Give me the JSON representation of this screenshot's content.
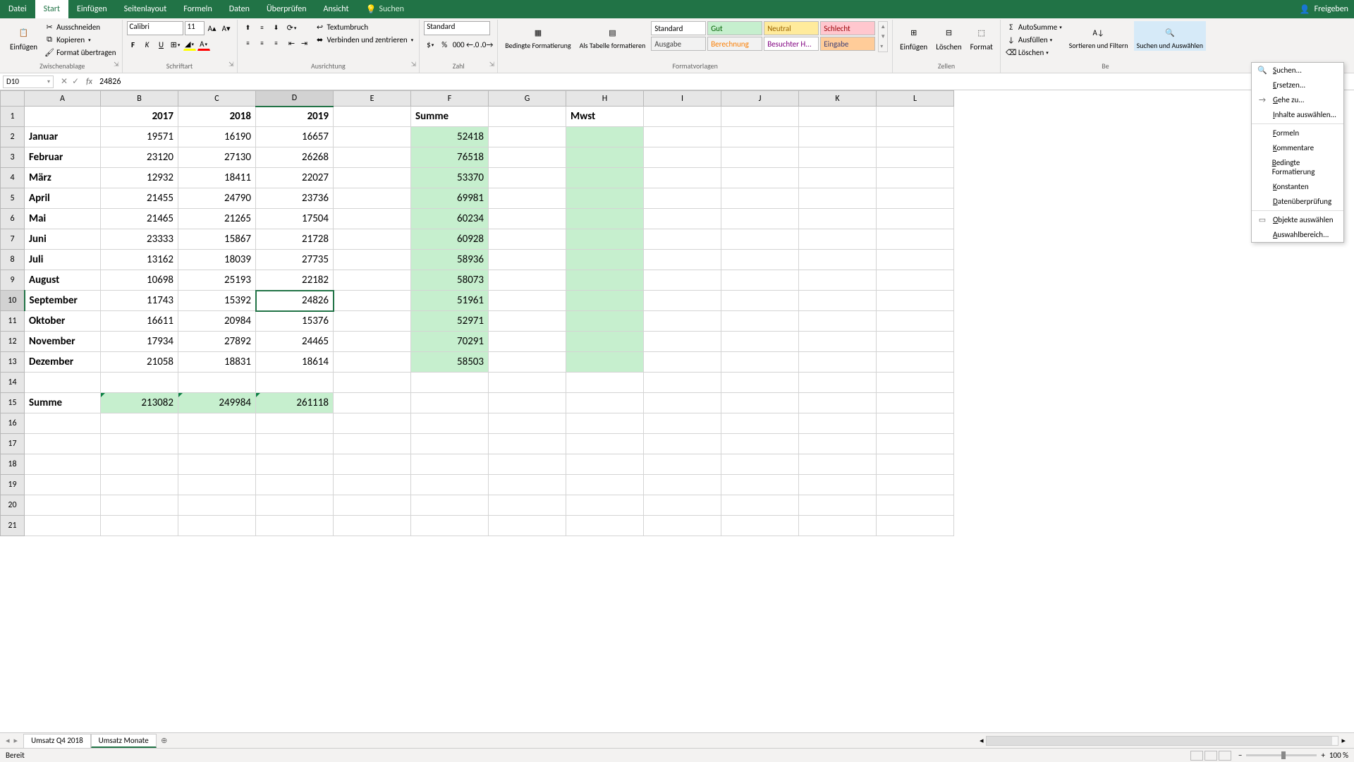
{
  "titlebar": {
    "tabs": [
      "Datei",
      "Start",
      "Einfügen",
      "Seitenlayout",
      "Formeln",
      "Daten",
      "Überprüfen",
      "Ansicht"
    ],
    "active_tab": "Start",
    "search_label": "Suchen",
    "share_label": "Freigeben"
  },
  "ribbon": {
    "clipboard": {
      "paste": "Einfügen",
      "cut": "Ausschneiden",
      "copy": "Kopieren",
      "format_painter": "Format übertragen",
      "title": "Zwischenablage"
    },
    "font": {
      "name": "Calibri",
      "size": "11",
      "title": "Schriftart"
    },
    "alignment": {
      "wrap": "Textumbruch",
      "merge": "Verbinden und zentrieren",
      "title": "Ausrichtung"
    },
    "number": {
      "format": "Standard",
      "title": "Zahl"
    },
    "styles": {
      "cond": "Bedingte Formatierung",
      "table": "Als Tabelle formatieren",
      "cells": [
        {
          "label": "Standard",
          "bg": "#ffffff",
          "fg": "#000000"
        },
        {
          "label": "Gut",
          "bg": "#c6efce",
          "fg": "#006100"
        },
        {
          "label": "Neutral",
          "bg": "#ffeb9c",
          "fg": "#9c6500"
        },
        {
          "label": "Schlecht",
          "bg": "#ffc7ce",
          "fg": "#9c0006"
        },
        {
          "label": "Ausgabe",
          "bg": "#f2f2f2",
          "fg": "#3f3f3f"
        },
        {
          "label": "Berechnung",
          "bg": "#f2f2f2",
          "fg": "#fa7d00"
        },
        {
          "label": "Besuchter H...",
          "bg": "#ffffff",
          "fg": "#800080"
        },
        {
          "label": "Eingabe",
          "bg": "#ffcc99",
          "fg": "#3f3f76"
        }
      ],
      "title": "Formatvorlagen"
    },
    "cells_group": {
      "insert": "Einfügen",
      "delete": "Löschen",
      "format": "Format",
      "title": "Zellen"
    },
    "editing": {
      "autosum": "AutoSumme",
      "fill": "Ausfüllen",
      "clear": "Löschen",
      "sort": "Sortieren und Filtern",
      "find": "Suchen und Auswählen",
      "title": "Be"
    }
  },
  "dropdown": {
    "items": [
      {
        "label": "Suchen...",
        "icon": "🔍"
      },
      {
        "label": "Ersetzen...",
        "icon": ""
      },
      {
        "label": "Gehe zu...",
        "icon": "→"
      },
      {
        "label": "Inhalte auswählen...",
        "icon": ""
      },
      {
        "label": "Formeln",
        "icon": ""
      },
      {
        "label": "Kommentare",
        "icon": ""
      },
      {
        "label": "Bedingte Formatierung",
        "icon": ""
      },
      {
        "label": "Konstanten",
        "icon": ""
      },
      {
        "label": "Datenüberprüfung",
        "icon": ""
      },
      {
        "label": "Objekte auswählen",
        "icon": "▭"
      },
      {
        "label": "Auswahlbereich...",
        "icon": ""
      }
    ]
  },
  "formulabar": {
    "namebox": "D10",
    "value": "24826"
  },
  "columns": [
    "A",
    "B",
    "C",
    "D",
    "E",
    "F",
    "G",
    "H",
    "I",
    "J",
    "K",
    "L"
  ],
  "selected_col": "D",
  "selected_row": 10,
  "sheet": {
    "headers": {
      "b": "2017",
      "c": "2018",
      "d": "2019",
      "f": "Summe",
      "h": "Mwst"
    },
    "rows": [
      {
        "a": "Januar",
        "b": 19571,
        "c": 16190,
        "d": 16657,
        "f": 52418
      },
      {
        "a": "Februar",
        "b": 23120,
        "c": 27130,
        "d": 26268,
        "f": 76518
      },
      {
        "a": "März",
        "b": 12932,
        "c": 18411,
        "d": 22027,
        "f": 53370
      },
      {
        "a": "April",
        "b": 21455,
        "c": 24790,
        "d": 23736,
        "f": 69981
      },
      {
        "a": "Mai",
        "b": 21465,
        "c": 21265,
        "d": 17504,
        "f": 60234
      },
      {
        "a": "Juni",
        "b": 23333,
        "c": 15867,
        "d": 21728,
        "f": 60928
      },
      {
        "a": "Juli",
        "b": 13162,
        "c": 18039,
        "d": 27735,
        "f": 58936
      },
      {
        "a": "August",
        "b": 10698,
        "c": 25193,
        "d": 22182,
        "f": 58073
      },
      {
        "a": "September",
        "b": 11743,
        "c": 15392,
        "d": 24826,
        "f": 51961
      },
      {
        "a": "Oktober",
        "b": 16611,
        "c": 20984,
        "d": 15376,
        "f": 52971
      },
      {
        "a": "November",
        "b": 17934,
        "c": 27892,
        "d": 24465,
        "f": 70291
      },
      {
        "a": "Dezember",
        "b": 21058,
        "c": 18831,
        "d": 18614,
        "f": 58503
      }
    ],
    "sum_label": "Summe",
    "sums": {
      "b": 213082,
      "c": 249984,
      "d": 261118
    }
  },
  "tabs": {
    "sheets": [
      "Umsatz Q4 2018",
      "Umsatz Monate"
    ],
    "active": "Umsatz Monate"
  },
  "statusbar": {
    "ready": "Bereit",
    "zoom": "100 %"
  }
}
